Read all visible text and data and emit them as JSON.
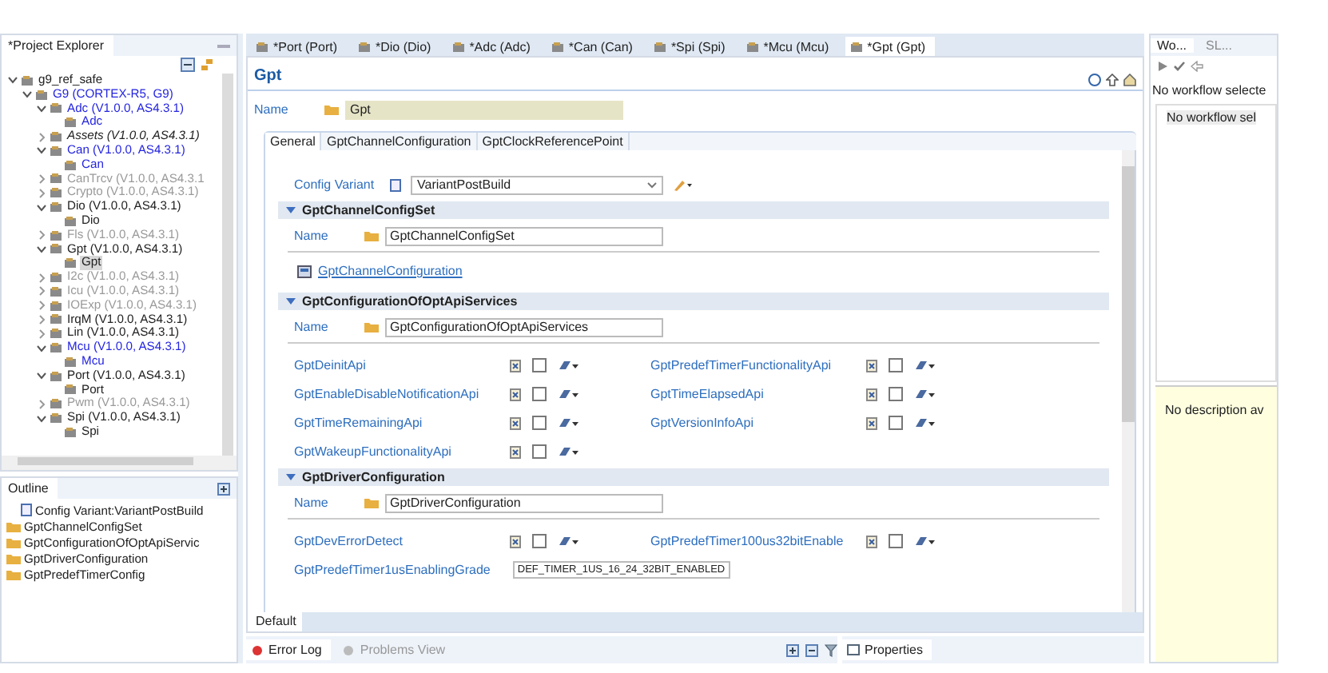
{
  "project_explorer": {
    "title": "*Project Explorer",
    "tree": [
      {
        "label": "g9_ref_safe",
        "kind": "normal",
        "expanded": true,
        "selected": false,
        "children": [
          {
            "label": "G9 (CORTEX-R5, G9)",
            "kind": "modified",
            "expanded": true,
            "selected": false,
            "children": [
              {
                "label": "Adc (V1.0.0, AS4.3.1)",
                "kind": "modified",
                "expanded": true,
                "selected": false,
                "children": [
                  {
                    "label": "Adc",
                    "kind": "modified",
                    "selected": false
                  }
                ]
              },
              {
                "label": "Assets (V1.0.0, AS4.3.1)",
                "kind": "external",
                "expanded": false,
                "selected": false
              },
              {
                "label": "Can (V1.0.0, AS4.3.1)",
                "kind": "modified",
                "expanded": true,
                "selected": false,
                "children": [
                  {
                    "label": "Can",
                    "kind": "modified",
                    "selected": false
                  }
                ]
              },
              {
                "label": "CanTrcv (V1.0.0, AS4.3.1",
                "kind": "disabled",
                "expanded": false,
                "selected": false
              },
              {
                "label": "Crypto (V1.0.0, AS4.3.1)",
                "kind": "disabled",
                "expanded": false,
                "selected": false
              },
              {
                "label": "Dio (V1.0.0, AS4.3.1)",
                "kind": "normal",
                "expanded": true,
                "selected": false,
                "children": [
                  {
                    "label": "Dio",
                    "kind": "normal",
                    "selected": false
                  }
                ]
              },
              {
                "label": "Fls (V1.0.0, AS4.3.1)",
                "kind": "disabled",
                "expanded": false,
                "selected": false
              },
              {
                "label": "Gpt (V1.0.0, AS4.3.1)",
                "kind": "normal",
                "expanded": true,
                "selected": false,
                "children": [
                  {
                    "label": "Gpt",
                    "kind": "normal",
                    "selected": true
                  }
                ]
              },
              {
                "label": "I2c (V1.0.0, AS4.3.1)",
                "kind": "disabled",
                "expanded": false,
                "selected": false
              },
              {
                "label": "Icu (V1.0.0, AS4.3.1)",
                "kind": "disabled",
                "expanded": false,
                "selected": false
              },
              {
                "label": "IOExp (V1.0.0, AS4.3.1)",
                "kind": "disabled",
                "expanded": false,
                "selected": false
              },
              {
                "label": "IrqM (V1.0.0, AS4.3.1)",
                "kind": "normal",
                "expanded": false,
                "selected": false
              },
              {
                "label": "Lin (V1.0.0, AS4.3.1)",
                "kind": "normal",
                "expanded": false,
                "selected": false
              },
              {
                "label": "Mcu (V1.0.0, AS4.3.1)",
                "kind": "modified",
                "expanded": true,
                "selected": false,
                "children": [
                  {
                    "label": "Mcu",
                    "kind": "modified",
                    "selected": false
                  }
                ]
              },
              {
                "label": "Port (V1.0.0, AS4.3.1)",
                "kind": "normal",
                "expanded": true,
                "selected": false,
                "children": [
                  {
                    "label": "Port",
                    "kind": "normal",
                    "selected": false
                  }
                ]
              },
              {
                "label": "Pwm (V1.0.0, AS4.3.1)",
                "kind": "disabled",
                "expanded": false,
                "selected": false
              },
              {
                "label": "Spi (V1.0.0, AS4.3.1)",
                "kind": "normal",
                "expanded": true,
                "selected": false,
                "children": [
                  {
                    "label": "Spi",
                    "kind": "normal",
                    "selected": false
                  }
                ]
              }
            ]
          }
        ]
      }
    ]
  },
  "outline": {
    "title": "Outline",
    "items": [
      {
        "label": "Config Variant:VariantPostBuild",
        "kind": "variant"
      },
      {
        "label": "GptChannelConfigSet",
        "kind": "folder"
      },
      {
        "label": "GptConfigurationOfOptApiServic",
        "kind": "folder"
      },
      {
        "label": "GptDriverConfiguration",
        "kind": "folder"
      },
      {
        "label": "GptPredefTimerConfig",
        "kind": "folder"
      }
    ]
  },
  "editor_tabs": [
    {
      "label": "*Port (Port)",
      "selected": false
    },
    {
      "label": "*Dio (Dio)",
      "selected": false
    },
    {
      "label": "*Adc (Adc)",
      "selected": false
    },
    {
      "label": "*Can (Can)",
      "selected": false
    },
    {
      "label": "*Spi (Spi)",
      "selected": false
    },
    {
      "label": "*Mcu (Mcu)",
      "selected": false
    },
    {
      "label": "*Gpt (Gpt)",
      "selected": true
    }
  ],
  "editor": {
    "title": "Gpt",
    "name_label": "Name",
    "name_value": "Gpt",
    "tabs": [
      {
        "label": "General",
        "selected": true
      },
      {
        "label": "GptChannelConfiguration",
        "selected": false
      },
      {
        "label": "GptClockReferencePoint",
        "selected": false
      }
    ],
    "config_variant": {
      "label": "Config Variant",
      "value": "VariantPostBuild"
    },
    "sections": [
      {
        "title": "GptChannelConfigSet",
        "expanded": true,
        "name_label": "Name",
        "name_value": "GptChannelConfigSet",
        "links": [
          "GptChannelConfiguration"
        ]
      },
      {
        "title": "GptConfigurationOfOptApiServices",
        "expanded": true,
        "name_label": "Name",
        "name_value": "GptConfigurationOfOptApiServices",
        "params": [
          {
            "label": "GptDeinitApi",
            "kind": "checkbox",
            "checked": false
          },
          {
            "label": "GptPredefTimerFunctionalityApi",
            "kind": "checkbox",
            "checked": false
          },
          {
            "label": "GptEnableDisableNotificationApi",
            "kind": "checkbox",
            "checked": false
          },
          {
            "label": "GptTimeElapsedApi",
            "kind": "checkbox",
            "checked": false
          },
          {
            "label": "GptTimeRemainingApi",
            "kind": "checkbox",
            "checked": false
          },
          {
            "label": "GptVersionInfoApi",
            "kind": "checkbox",
            "checked": false
          },
          {
            "label": "GptWakeupFunctionalityApi",
            "kind": "checkbox",
            "checked": false
          }
        ]
      },
      {
        "title": "GptDriverConfiguration",
        "expanded": true,
        "name_label": "Name",
        "name_value": "GptDriverConfiguration",
        "params": [
          {
            "label": "GptDevErrorDetect",
            "kind": "checkbox",
            "checked": false
          },
          {
            "label": "GptPredefTimer100us32bitEnable",
            "kind": "checkbox",
            "checked": false
          },
          {
            "label": "GptPredefTimer1usEnablingGrade",
            "kind": "dropdown",
            "value": "DEF_TIMER_1US_16_24_32BIT_ENABLED"
          }
        ]
      }
    ],
    "bottom_tab": "Default"
  },
  "bottom_panel": {
    "tabs": [
      {
        "label": "Error Log",
        "selected": true
      },
      {
        "label": "Problems View",
        "selected": false
      }
    ],
    "properties": "Properties"
  },
  "workflow": {
    "tabs": [
      {
        "label": "Wo...",
        "selected": true
      },
      {
        "label": "SL...",
        "selected": false
      }
    ],
    "header": "No workflow selecte",
    "list_item": "No workflow sel",
    "description": "No description av"
  }
}
